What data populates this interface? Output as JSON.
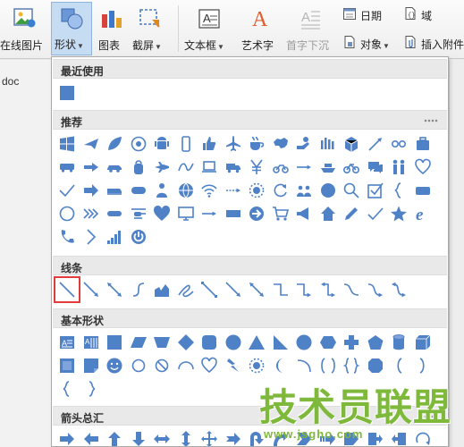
{
  "ribbon": {
    "online_image": "在线图片",
    "shape": "形状",
    "chart": "图表",
    "screenshot": "截屏",
    "textbox": "文本框",
    "wordart": "艺术字",
    "drop_cap": "首字下沉",
    "date": "日期",
    "field": "域",
    "object": "对象",
    "insert_attachment": "插入附件"
  },
  "document": {
    "filename_fragment": "doc"
  },
  "panel": {
    "sections": [
      {
        "title": "最近使用"
      },
      {
        "title": "推荐"
      },
      {
        "title": "线条"
      },
      {
        "title": "基本形状"
      },
      {
        "title": "箭头总汇"
      }
    ],
    "selected_shape": "line"
  },
  "colors": {
    "icon_fill": "#4f81c7",
    "selection_border": "#e03c3c",
    "watermark": "#7fb93b"
  },
  "watermark": {
    "title": "技术员联盟",
    "url": "www.jsgho.com"
  },
  "icons": {
    "recent": [
      "rect"
    ],
    "recommended": [
      "windows",
      "plane",
      "leaf",
      "at",
      "android",
      "phone",
      "thumbs-up",
      "airplane",
      "coffee",
      "china-map",
      "lightbulb-hand",
      "vote",
      "box",
      "arrow-ne",
      "cycle",
      "suitcase",
      "bus",
      "arrow-right",
      "car",
      "bag",
      "jet",
      "rollercoaster",
      "laptop",
      "truck",
      "yen",
      "motorbike",
      "arrow-right-thin",
      "ship",
      "bicycle",
      "chat",
      "people",
      "heart",
      "check",
      "arrow-bold",
      "train",
      "pill",
      "person",
      "globe",
      "wifi",
      "arrow-dotted",
      "sun",
      "refresh",
      "group",
      "circle",
      "magnifier",
      "checkbox",
      "brace",
      "rounded-rect",
      "ring",
      "chevrons",
      "pill-long",
      "helicopter",
      "heart-solid",
      "monitor",
      "arrow-plain",
      "bar",
      "arrow-circle",
      "cart",
      "megaphone",
      "house",
      "pencil",
      "checkmark",
      "star",
      "ie",
      "phone-handset",
      "chevron",
      "signal",
      "power"
    ],
    "lines": [
      "line",
      "arrow-line",
      "double-arrow-line",
      "curve",
      "freeform",
      "scribble",
      "elbow",
      "elbow-arrow",
      "elbow-double",
      "connector1",
      "connector2",
      "connector3",
      "connector4",
      "connector5",
      "connector6"
    ],
    "basic": [
      "textbox",
      "vtextbox",
      "rect",
      "parallelogram",
      "trapezoid",
      "diamond",
      "rounded",
      "oval",
      "triangle",
      "rtriangle",
      "octagon",
      "hexagon",
      "cross",
      "pentagon",
      "can",
      "cube",
      "bevel",
      "folded",
      "smiley",
      "donut",
      "no",
      "arc",
      "heart",
      "lightning",
      "sun",
      "moon",
      "arc2",
      "bracket-pair",
      "brace-pair",
      "octagon2",
      "left-bracket",
      "right-bracket",
      "left-brace",
      "right-brace"
    ],
    "arrows": [
      "right-arrow",
      "left-arrow",
      "up-arrow",
      "down-arrow",
      "left-right",
      "up-down",
      "quad",
      "notch",
      "uturn",
      "curved-right",
      "chevron-arrow",
      "striped",
      "pentagon-arrow",
      "callout-right",
      "callout-left",
      "circle-arrow"
    ]
  }
}
